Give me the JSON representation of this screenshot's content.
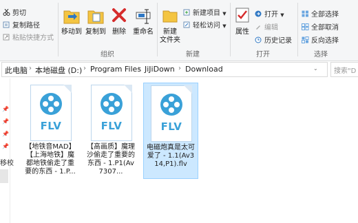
{
  "ribbon": {
    "clipboard": {
      "cut": "剪切",
      "copy_path": "复制路径",
      "paste_shortcut": "粘贴快捷方式"
    },
    "organize": {
      "group_label": "组织",
      "move_to": "移动到",
      "copy_to": "复制到",
      "delete": "删除",
      "rename": "重命名"
    },
    "new": {
      "group_label": "新建",
      "new_item": "新建项目",
      "easy_access": "轻松访问",
      "new_folder": "新建\n文件夹"
    },
    "open": {
      "group_label": "打开",
      "properties": "属性",
      "open": "打开",
      "edit": "编辑",
      "history": "历史记录"
    },
    "select": {
      "group_label": "选择",
      "select_all": "全部选择",
      "select_none": "全部取消",
      "invert": "反向选择"
    }
  },
  "address": {
    "crumbs": [
      "此电脑",
      "本地磁盘 (D:)",
      "Program Files",
      "JiJiDown",
      "Download"
    ],
    "search_placeholder": "搜索\"D"
  },
  "nav": {
    "partial_label": "移校"
  },
  "files": [
    {
      "ext": "FLV",
      "name": "【地铁音MAD】【上海地铁】魔都地铁偷走了重要的东西 - 1.P...",
      "selected": false
    },
    {
      "ext": "FLV",
      "name": "【高画质】魔理沙偷走了重要的东西 - 1.P1(Av7307...",
      "selected": false
    },
    {
      "ext": "FLV",
      "name": "电磁炮真是太可爱了 - 1.1(Av314,P1).flv",
      "selected": true
    }
  ],
  "colors": {
    "file_accent": "#3aa1d8",
    "selection": "#cce8ff"
  }
}
